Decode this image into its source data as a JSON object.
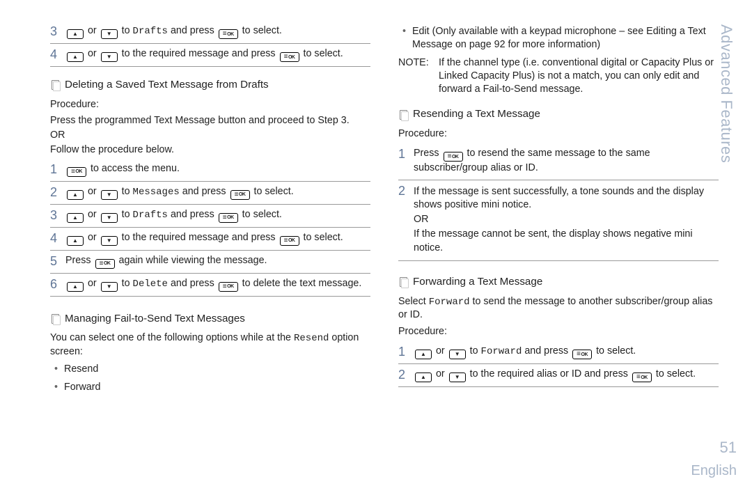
{
  "side_tab": "Advanced Features",
  "page_number": "51",
  "language": "English",
  "left": {
    "s3_a": " or ",
    "s3_b": " to ",
    "s3_drafts": "Drafts",
    "s3_c": " and press ",
    "s3_d": " to select.",
    "s4_a": " or ",
    "s4_b": " to the required message and press ",
    "s4_c": " to select.",
    "h_del": "Deleting a Saved Text Message from Drafts",
    "proc": "Procedure:",
    "intro1": "Press the programmed Text Message  button and proceed to Step 3.",
    "intro_or": "OR",
    "intro2": "Follow the procedure below.",
    "d1": " to access the menu.",
    "d2_a": " or ",
    "d2_b": " to ",
    "d2_msgs": "Messages",
    "d2_c": " and press ",
    "d2_d": " to select.",
    "d3_a": " or ",
    "d3_b": " to ",
    "d3_drafts": "Drafts",
    "d3_c": " and press ",
    "d3_d": " to select.",
    "d4_a": " or ",
    "d4_b": " to the required message and press ",
    "d4_c": " to select.",
    "d5_a": "Press ",
    "d5_b": " again while viewing the message.",
    "d6_a": " or ",
    "d6_b": " to ",
    "d6_del": "Delete",
    "d6_c": " and press ",
    "d6_d": " to delete the text message.",
    "h_fail": "Managing Fail-to-Send Text Messages",
    "fail_intro_a": "You can select one of the following options while at the ",
    "fail_resend": "Resend",
    "fail_intro_b": " option screen:",
    "b_resend": "Resend",
    "b_forward": "Forward"
  },
  "right": {
    "edit": "Edit (Only available with a keypad microphone – see Editing a Text Message  on page 92 for more information)",
    "note_label": "NOTE:",
    "note_text": "If the channel type (i.e. conventional digital or Capacity Plus or Linked Capacity Plus) is not a match, you can only edit and forward a Fail-to-Send message.",
    "h_resend": "Resending a Text Message",
    "proc": "Procedure:",
    "r1_a": "Press ",
    "r1_b": " to resend the same message to the same subscriber/group alias or ID.",
    "r2_a": "If the message is sent successfully, a tone sounds and the display shows positive mini notice.",
    "r2_or": "OR",
    "r2_b": "If the message cannot be sent, the display shows negative mini notice.",
    "h_fwd": "Forwarding a Text Message",
    "fwd_intro_a": "Select ",
    "fwd_intro_fwd": "Forward",
    "fwd_intro_b": " to send the message to another subscriber/group alias or ID.",
    "f1_a": " or ",
    "f1_b": " to ",
    "f1_fwd": "Forward",
    "f1_c": " and press ",
    "f1_d": " to select.",
    "f2_a": " or ",
    "f2_b": " to the required alias or ID and press ",
    "f2_c": " to select."
  },
  "nums": {
    "n1": "1",
    "n2": "2",
    "n3": "3",
    "n4": "4",
    "n5": "5",
    "n6": "6"
  }
}
